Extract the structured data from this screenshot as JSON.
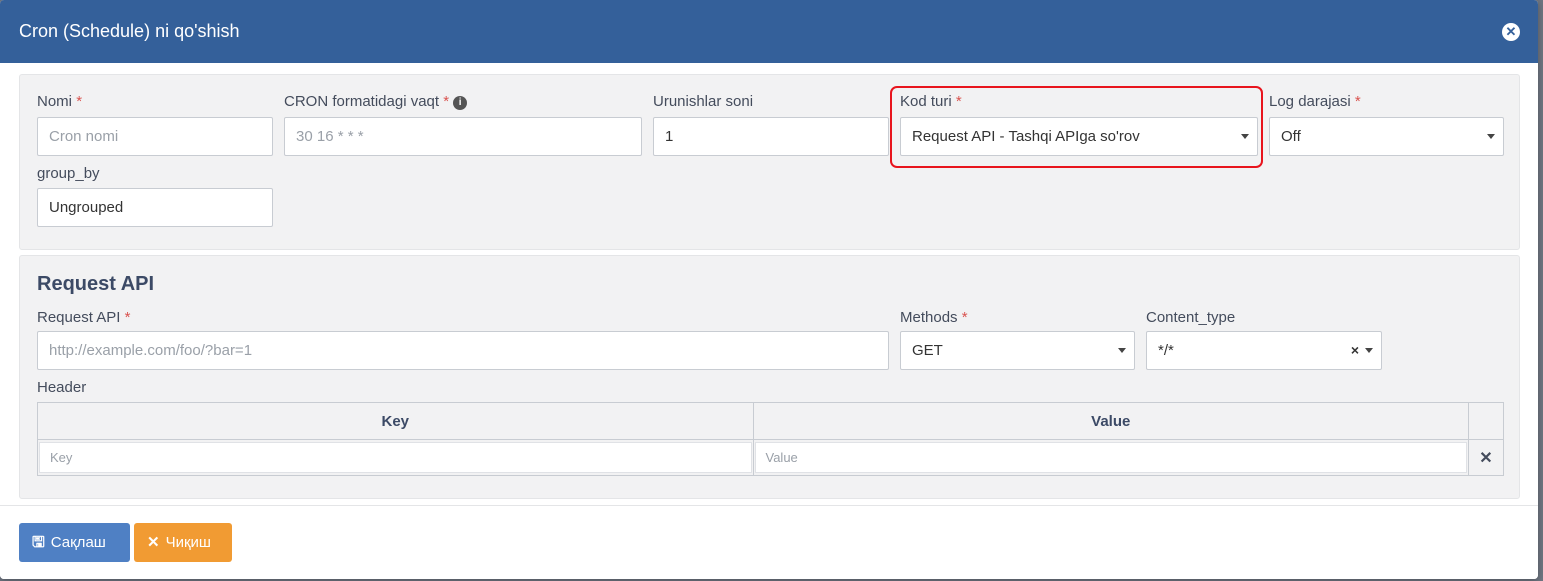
{
  "modal": {
    "title": "Cron (Schedule) ni qo'shish",
    "close_icon": "close-circle-icon"
  },
  "general": {
    "name": {
      "label": "Nomi",
      "required": "*",
      "placeholder": "Cron nomi"
    },
    "cron": {
      "label": "CRON formatidagi vaqt",
      "required": "*",
      "placeholder": "30 16 * * *",
      "info_icon": "i"
    },
    "attempts": {
      "label": "Urunishlar soni",
      "value": "1"
    },
    "code_type": {
      "label": "Kod turi",
      "required": "*",
      "value": "Request API - Tashqi APIga so'rov"
    },
    "log_level": {
      "label": "Log darajasi",
      "required": "*",
      "value": "Off"
    },
    "group_by": {
      "label": "group_by",
      "value": "Ungrouped"
    }
  },
  "request_api": {
    "section_title": "Request API",
    "url": {
      "label": "Request API",
      "required": "*",
      "placeholder": "http://example.com/foo/?bar=1"
    },
    "methods": {
      "label": "Methods",
      "required": "*",
      "value": "GET"
    },
    "content_type": {
      "label": "Content_type",
      "value": "*/*",
      "clear": "×"
    },
    "header": {
      "label": "Header",
      "columns": [
        "Key",
        "Value"
      ],
      "row": {
        "key_placeholder": "Key",
        "value_placeholder": "Value",
        "remove": "✕"
      }
    }
  },
  "footer": {
    "save_label": "Сақлаш",
    "save_icon": "floppy-disk-icon",
    "exit_label": "Чиқиш",
    "exit_icon": "times-icon"
  },
  "colors": {
    "header_bg": "#34609a",
    "save_btn": "#4f80c4",
    "exit_btn": "#f19b33",
    "highlight": "#e8141d"
  }
}
